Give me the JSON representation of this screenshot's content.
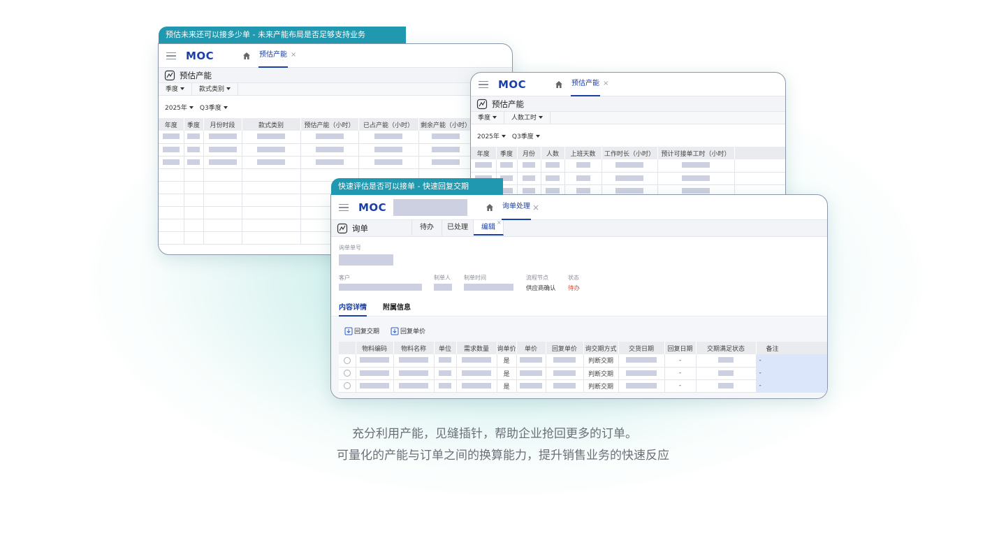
{
  "taglines": [
    "充分利用产能，见缝插针，帮助企业抢回更多的订单。",
    "可量化的产能与订单之间的换算能力，提升销售业务的快速反应"
  ],
  "win1": {
    "caption": "预估未来还可以接多少单 - 未来产能布局是否足够支持业务",
    "logo": "MOC",
    "tab": "预估产能",
    "page_title": "预估产能",
    "filters": [
      "季度",
      "款式类别"
    ],
    "selects": [
      "2025年",
      "Q3季度"
    ],
    "columns": [
      "年度",
      "季度",
      "月份时段",
      "款式类别",
      "预估产能（小时）",
      "已占产能（小时）",
      "剩余产能（小时）"
    ]
  },
  "win2": {
    "logo": "MOC",
    "tab": "预估产能",
    "page_title": "预估产能",
    "filters": [
      "季度",
      "人数工时"
    ],
    "selects": [
      "2025年",
      "Q3季度"
    ],
    "columns": [
      "年度",
      "季度",
      "月份",
      "人数",
      "上班天数",
      "工作时长（小时）",
      "预计可接单工时（小时）"
    ]
  },
  "win3": {
    "caption": "快速评估是否可以接单 - 快速回复交期",
    "logo": "MOC",
    "tab": "询单处理",
    "page_title": "询单",
    "status_tabs": [
      "待办",
      "已处理",
      "编辑"
    ],
    "fields": {
      "order_no_label": "询单单号",
      "customer_label": "客户",
      "creator_label": "制单人",
      "created_label": "制单时间",
      "node_label": "流程节点",
      "node_value": "供应商确认",
      "status_label": "状态",
      "status_value": "待办"
    },
    "section_tabs": [
      "内容详情",
      "附属信息"
    ],
    "actions": [
      "回复交期",
      "回复单价"
    ],
    "columns": [
      "物料编码",
      "物料名称",
      "单位",
      "需求数量",
      "询单价",
      "单价",
      "回复单价",
      "询交期方式",
      "交货日期",
      "回复日期",
      "交期满足状态",
      "备注"
    ],
    "rows": [
      {
        "inquiry_price": "是",
        "method": "判断交期",
        "reply_date": "-",
        "note": "-"
      },
      {
        "inquiry_price": "是",
        "method": "判断交期",
        "reply_date": "-",
        "note": "-"
      },
      {
        "inquiry_price": "是",
        "method": "判断交期",
        "reply_date": "-",
        "note": "-"
      }
    ]
  },
  "colors": {
    "accent": "#1a3fa8",
    "caption_bg": "#1f98b0",
    "status_red": "#e04b3a",
    "placeholder": "#ccd0e0"
  },
  "icons": [
    "menu-icon",
    "home-icon",
    "close-icon",
    "page-icon",
    "reply-icon"
  ]
}
